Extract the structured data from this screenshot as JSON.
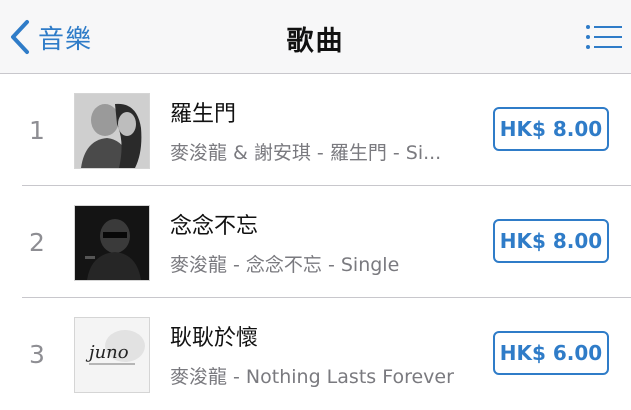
{
  "nav": {
    "back_label": "音樂",
    "title": "歌曲"
  },
  "colors": {
    "accent": "#2f7cc8",
    "navbar_bg": "#f7f7f8",
    "subtitle": "#7a7a7f",
    "separator": "#c8c7cc"
  },
  "songs": [
    {
      "rank": "1",
      "title": "羅生門",
      "subtitle": "麥浚龍 & 謝安琪 - 羅生門 - Si...",
      "price": "HK$ 8.00"
    },
    {
      "rank": "2",
      "title": "念念不忘",
      "subtitle": "麥浚龍 - 念念不忘 - Single",
      "price": "HK$ 8.00"
    },
    {
      "rank": "3",
      "title": "耿耿於懷",
      "subtitle": "麥浚龍 - Nothing Lasts Forever",
      "price": "HK$ 6.00",
      "art_text": "juno"
    }
  ]
}
